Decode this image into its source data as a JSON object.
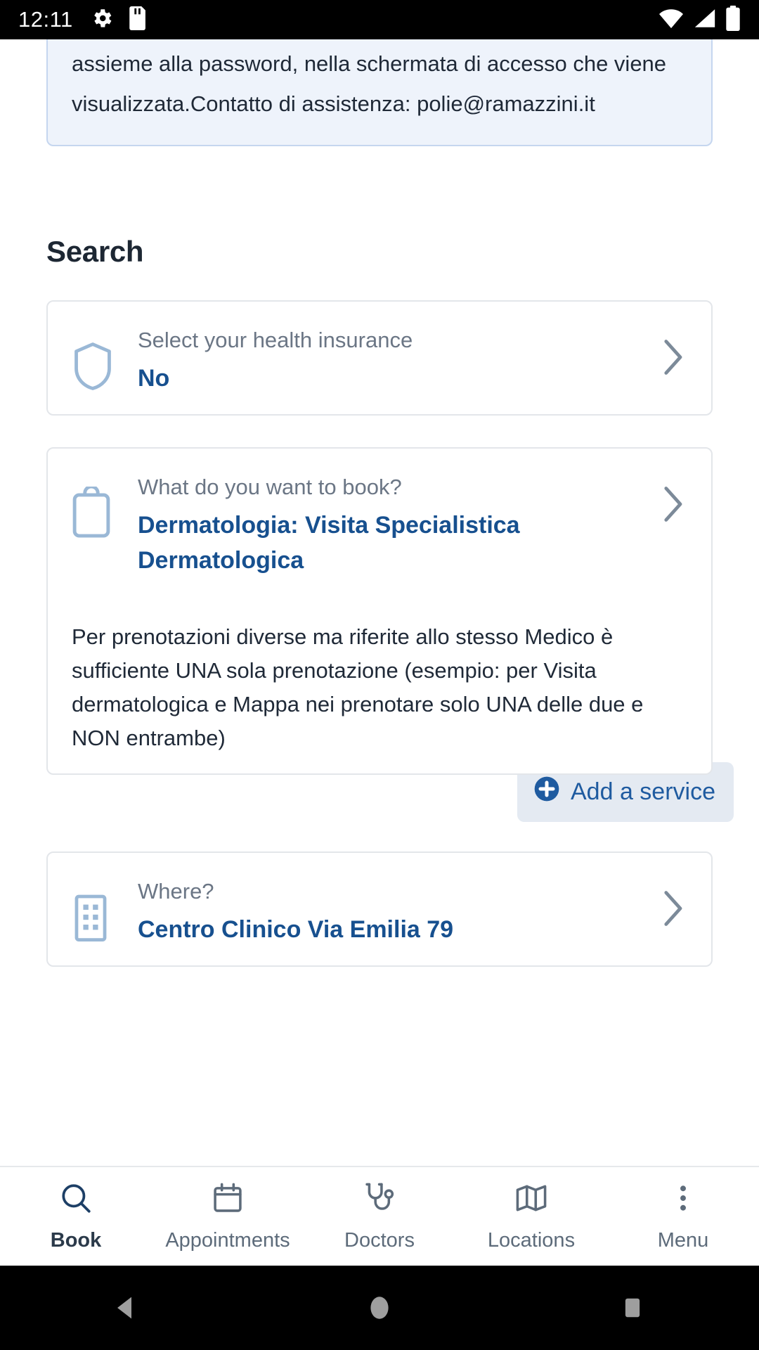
{
  "status_bar": {
    "clock": "12:11",
    "left_icons": [
      "gear-icon",
      "sd-card-icon"
    ],
    "right_icons": [
      "wifi-icon",
      "cellular-signal-icon",
      "battery-icon"
    ]
  },
  "info_banner": {
    "text": "assieme alla password, nella schermata di accesso che viene visualizzata.Contatto di assistenza: polie@ramazzini.it"
  },
  "search": {
    "title": "Search"
  },
  "insurance_card": {
    "icon": "shield-icon",
    "label": "Select your health insurance",
    "value": "No",
    "chevron": "chevron-right-icon"
  },
  "service_card": {
    "icon": "clipboard-icon",
    "label": "What do you want to book?",
    "value": "Dermatologia: Visita Specialistica Dermatologica",
    "chevron": "chevron-right-icon",
    "description": "Per prenotazioni diverse ma riferite allo stesso Medico è sufficiente UNA sola prenotazione (esempio: per Visita dermatologica e Mappa nei prenotare solo UNA delle due e NON entrambe)"
  },
  "add_service": {
    "label": "Add a service",
    "icon": "plus-circle-icon"
  },
  "where_card": {
    "icon": "building-icon",
    "label": "Where?",
    "value": "Centro Clinico Via Emilia 79",
    "chevron": "chevron-right-icon"
  },
  "tabbar": {
    "items": [
      {
        "label": "Book",
        "icon": "search-icon",
        "active": true
      },
      {
        "label": "Appointments",
        "icon": "calendar-icon",
        "active": false
      },
      {
        "label": "Doctors",
        "icon": "stethoscope-icon",
        "active": false
      },
      {
        "label": "Locations",
        "icon": "map-icon",
        "active": false
      },
      {
        "label": "Menu",
        "icon": "more-vertical-icon",
        "active": false
      }
    ]
  },
  "android_nav": {
    "back": "back-triangle-icon",
    "home": "home-circle-icon",
    "recents": "recents-square-icon"
  },
  "colors": {
    "accent_blue": "#17508f",
    "label_gray": "#6b7685",
    "banner_bg": "#eef3fb",
    "banner_border": "#c5d6ef",
    "icon_light_blue": "#9ab8d6",
    "button_bg": "#e4eaf2"
  }
}
